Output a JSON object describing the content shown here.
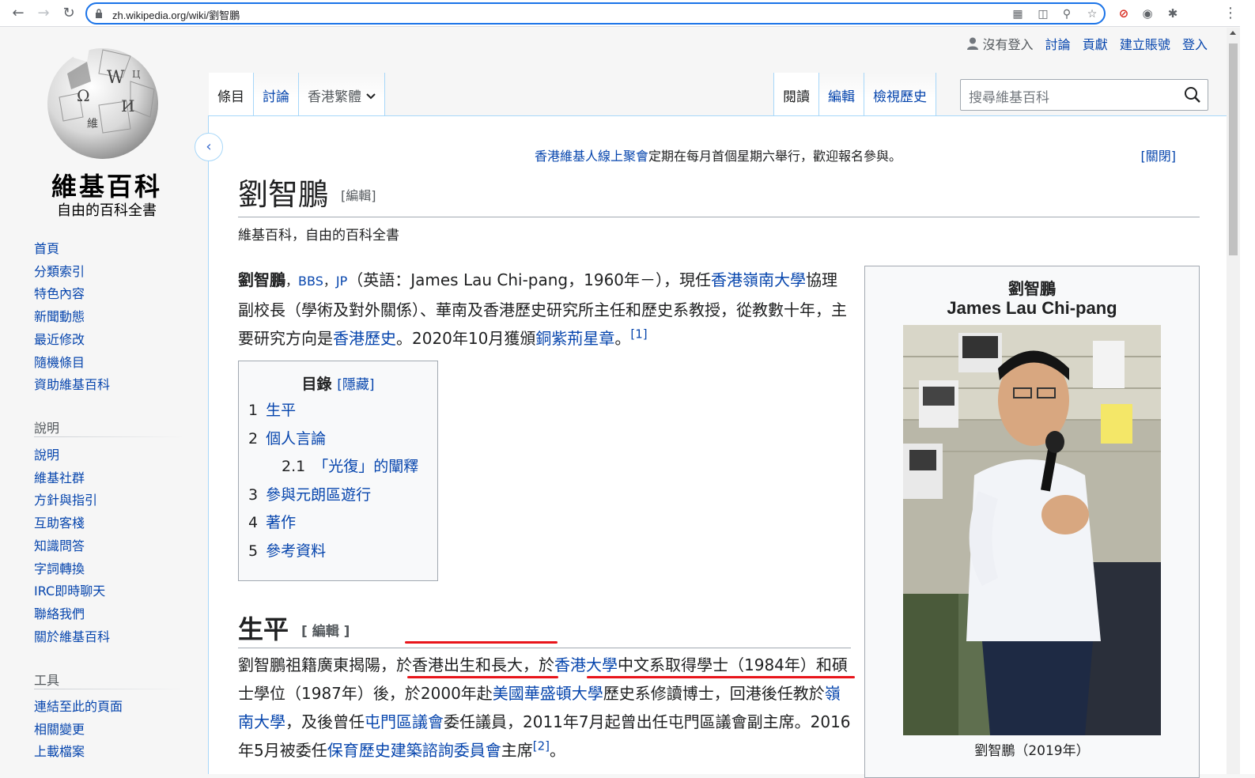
{
  "browser": {
    "url": "zh.wikipedia.org/wiki/劉智鵬"
  },
  "personal": {
    "not_logged_in": "沒有登入",
    "talk": "討論",
    "contributions": "貢獻",
    "create_account": "建立賬號",
    "login": "登入"
  },
  "tabs": {
    "article": "條目",
    "talk": "討論",
    "variant": "香港繁體",
    "read": "閱讀",
    "edit": "編輯",
    "history": "檢視歷史"
  },
  "search": {
    "placeholder": "搜尋維基百科"
  },
  "logo": {
    "wordmark": "維基百科",
    "tagline": "自由的百科全書"
  },
  "sidebar": {
    "navigation": [
      "首頁",
      "分類索引",
      "特色內容",
      "新聞動態",
      "最近修改",
      "隨機條目",
      "資助維基百科"
    ],
    "help_heading": "說明",
    "help": [
      "說明",
      "維基社群",
      "方針與指引",
      "互助客棧",
      "知識問答",
      "字詞轉換",
      "IRC即時聊天",
      "聯絡我們",
      "關於維基百科"
    ],
    "tools_heading": "工具",
    "tools": [
      "連結至此的頁面",
      "相關變更",
      "上載檔案"
    ]
  },
  "sitenotice": {
    "link": "香港維基人線上聚會",
    "text": "定期在每月首個星期六舉行，歡迎報名參與。",
    "close": "[關閉]"
  },
  "article": {
    "title": "劉智鵬",
    "edit_label": "[編輯]",
    "tagline": "維基百科，自由的百科全書",
    "lead": {
      "bold_name": "劉智鵬",
      "sep1": "，",
      "bbs": "BBS",
      "sep2": "，",
      "jp": "JP",
      "t1": "（英語：James Lau Chi-pang，1960年－），現任",
      "link_lingnan": "香港嶺南大學",
      "t2": "協理副校長（學術及對外關係）、華南及香港歷史研究所主任和歷史系教授，從教數十年，主要研究方向是",
      "link_hkhist": "香港歷史",
      "t3": "。2020年10月獲頒",
      "link_bbs": "銅紫荊星章",
      "t4": "。",
      "ref1": "[1]"
    },
    "toc": {
      "title": "目錄",
      "hide": "[隱藏]",
      "items": [
        {
          "num": "1",
          "label": "生平"
        },
        {
          "num": "2",
          "label": "個人言論"
        },
        {
          "num": "2.1",
          "label": "「光復」的闡釋"
        },
        {
          "num": "3",
          "label": "參與元朗區遊行"
        },
        {
          "num": "4",
          "label": "著作"
        },
        {
          "num": "5",
          "label": "參考資料"
        }
      ]
    },
    "section1": {
      "heading": "生平",
      "edit_label": "[ 編輯 ]",
      "t1": "劉智鵬祖籍廣東揭陽，於香港出生和長大，於",
      "link_hku": "香港大學",
      "t2": "中文系取得學士（1984年）和碩士學位（1987年）後，於2000年赴",
      "link_uw": "美國華盛頓大學",
      "t3": "歷史系修讀博士，回港後任教於",
      "link_ln": "嶺南大學",
      "t4": "，及後曾任",
      "link_tm": "屯門區議會",
      "t5": "委任議員，2011年7月起曾出任屯門區議會副主席。2016年5月被委任",
      "link_aab": "保育歷史建築諮詢委員會",
      "t6": "主席",
      "ref2": "[2]",
      "t7": "。"
    },
    "infobox": {
      "name_zh": "劉智鵬",
      "name_en": "James Lau Chi-pang",
      "caption": "劉智鵬（2019年）"
    }
  },
  "colors": {
    "link": "#0645ad",
    "border": "#a7d7f9",
    "annotation": "#e8151b"
  }
}
